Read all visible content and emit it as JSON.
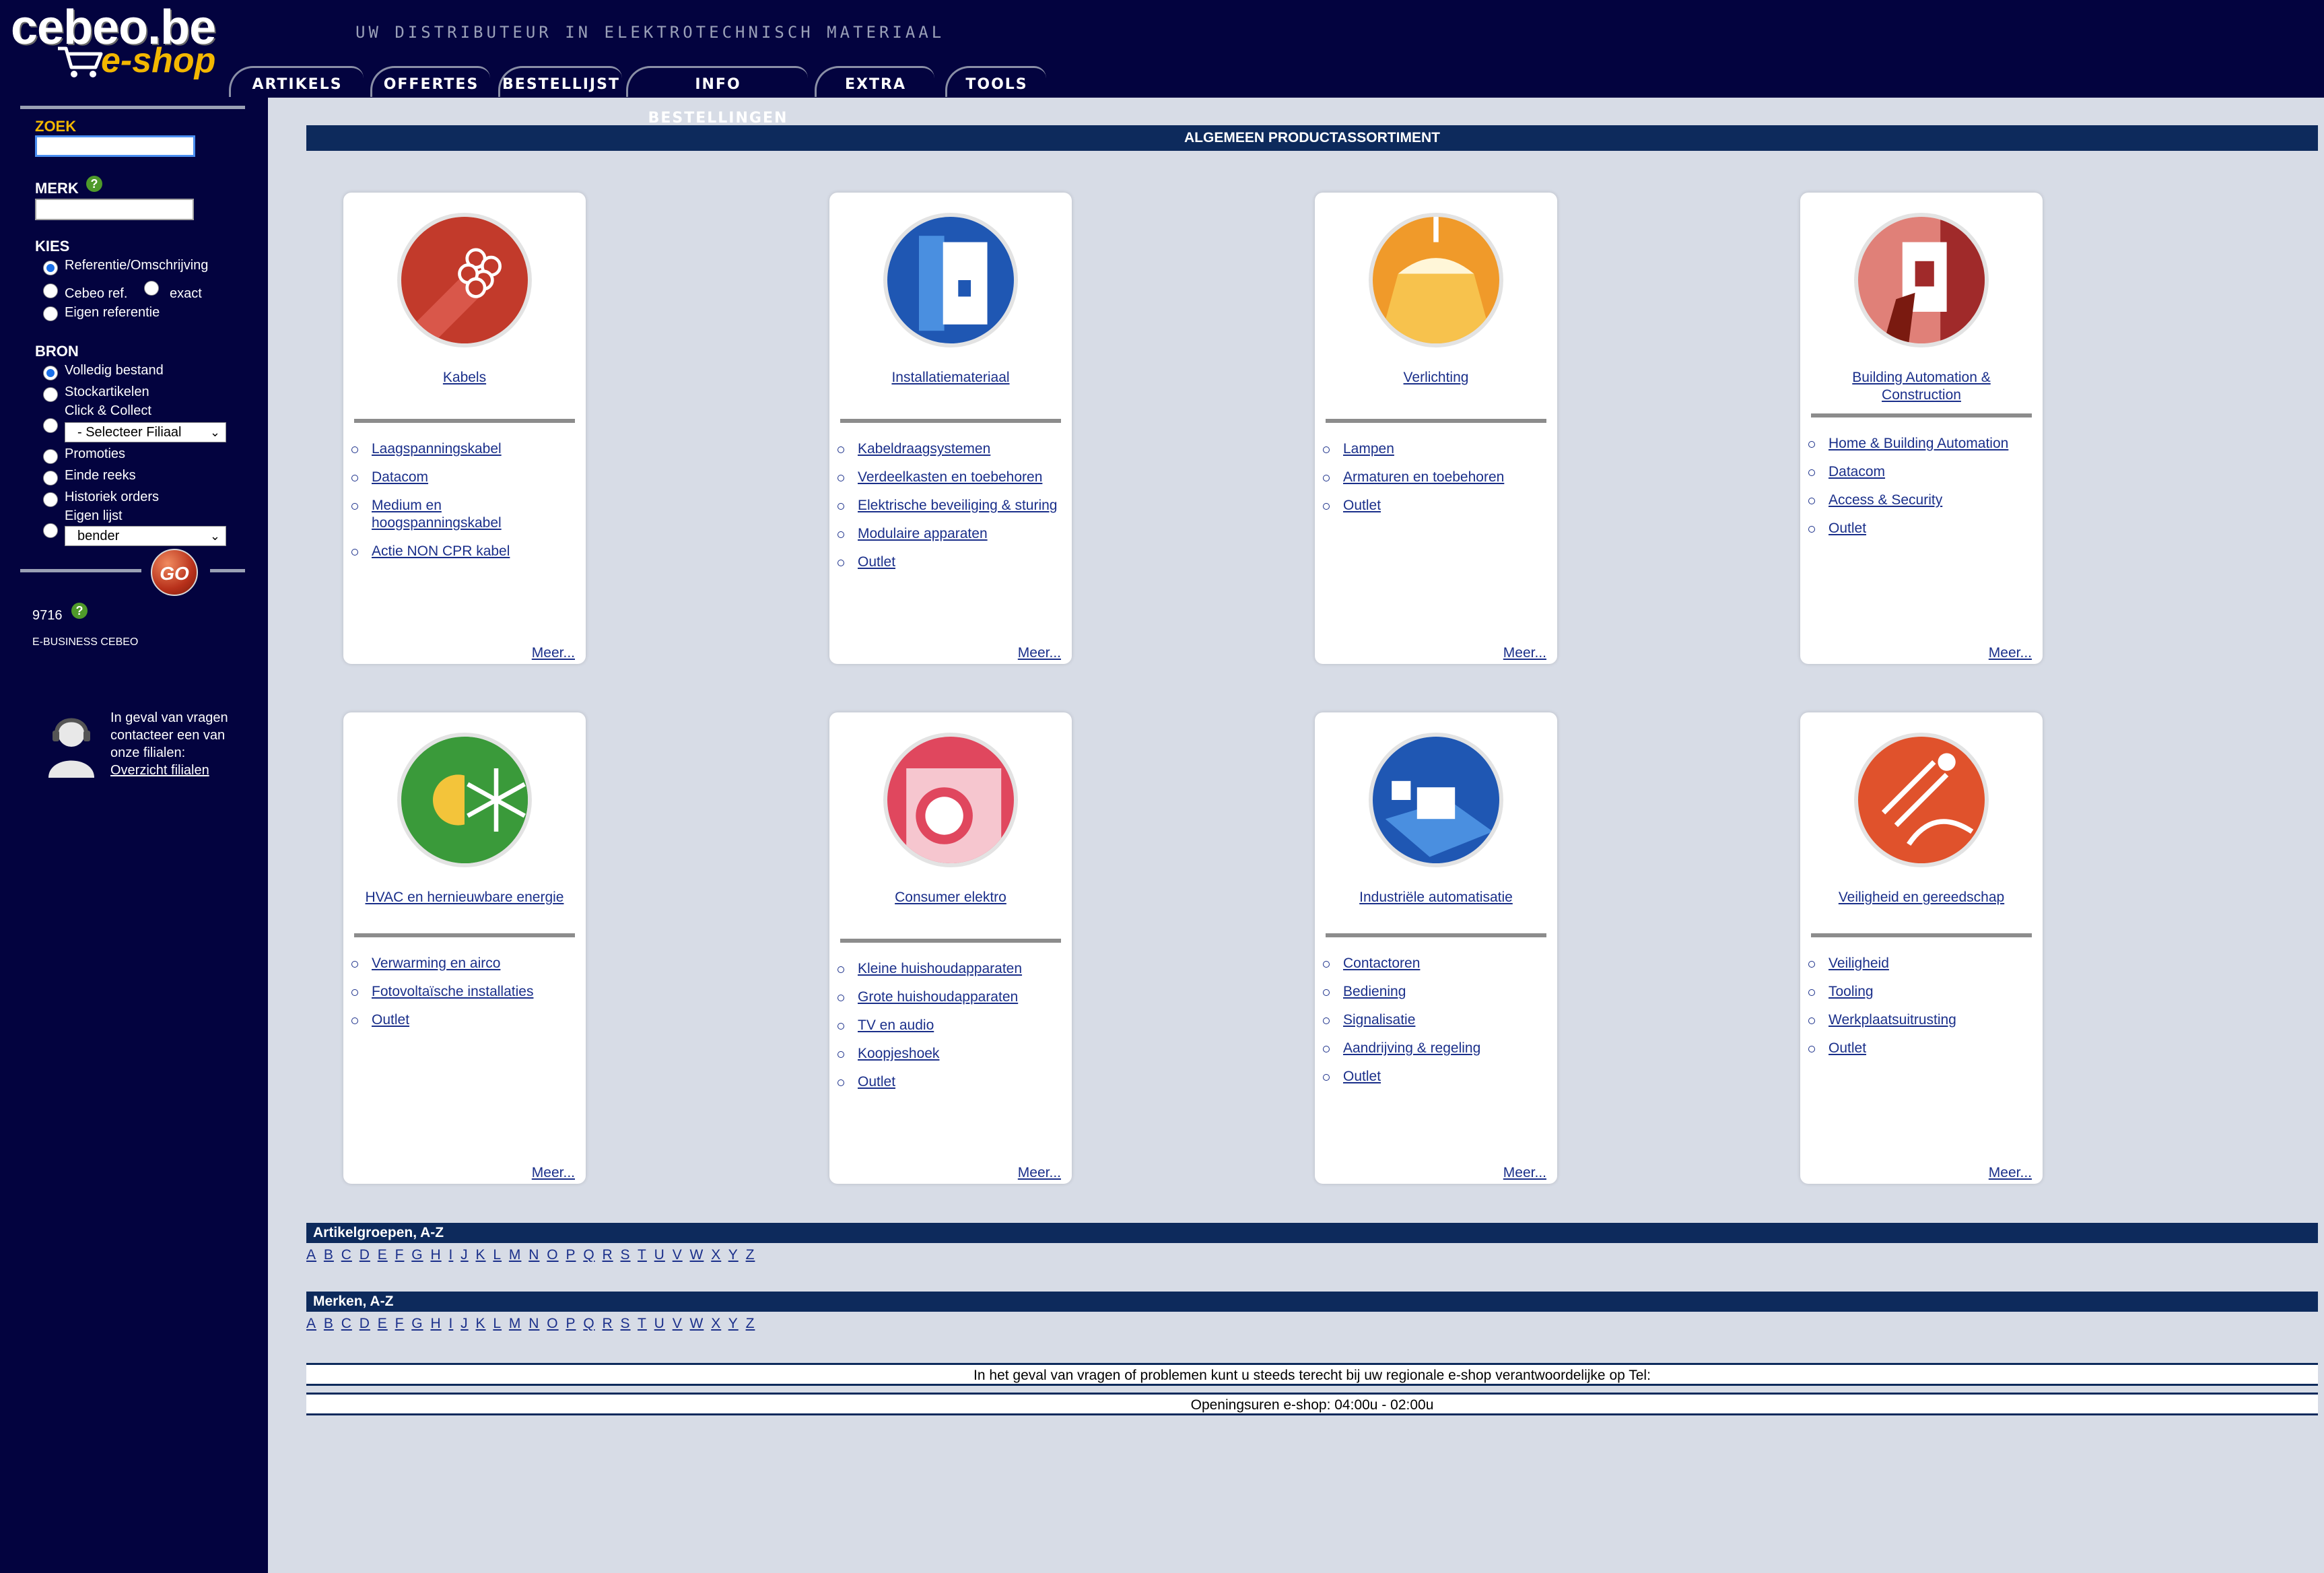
{
  "logo": {
    "main": "cebeo.be",
    "sub": "e-shop"
  },
  "tagline": "UW DISTRIBUTEUR IN ELEKTROTECHNISCH MATERIAAL",
  "nav": {
    "tabs": [
      "ARTIKELS",
      "OFFERTES",
      "BESTELLIJST",
      "INFO BESTELLINGEN",
      "EXTRA",
      "TOOLS"
    ]
  },
  "sidebar": {
    "zoek_label": "ZOEK",
    "merk_label": "MERK",
    "kies_label": "KIES",
    "kies_options": [
      "Referentie/Omschrijving",
      "Cebeo ref.",
      "exact",
      "Eigen referentie"
    ],
    "bron_label": "BRON",
    "bron_options": [
      "Volledig bestand",
      "Stockartikelen",
      "Click & Collect",
      "Promoties",
      "Einde reeks",
      "Historiek orders",
      "Eigen lijst"
    ],
    "filiaal_select": "- Selecteer Filiaal",
    "eigen_lijst_select": "bender",
    "go_label": "GO",
    "account_number": "9716",
    "account_name": "E-BUSINESS CEBEO",
    "contact_text": "In geval van vragen contacteer een van onze filialen:",
    "contact_link": "Overzicht filialen"
  },
  "main": {
    "section_title": "ALGEMEEN PRODUCTASSORTIMENT",
    "more_label": "Meer...",
    "categories": [
      {
        "title": "Kabels",
        "items": [
          "Laagspanningskabel",
          "Datacom",
          "Medium en hoogspanningskabel",
          "Actie NON CPR kabel"
        ]
      },
      {
        "title": "Installatiemateriaal",
        "items": [
          "Kabeldraagsystemen",
          "Verdeelkasten en toebehoren",
          "Elektrische beveiliging & sturing",
          "Modulaire apparaten",
          "Outlet"
        ]
      },
      {
        "title": "Verlichting",
        "items": [
          "Lampen",
          "Armaturen en toebehoren",
          "Outlet"
        ]
      },
      {
        "title": "Building Automation & Construction",
        "items": [
          "Home & Building Automation",
          "Datacom",
          "Access & Security",
          "Outlet"
        ]
      },
      {
        "title": "HVAC en hernieuwbare energie",
        "items": [
          "Verwarming en airco",
          "Fotovoltaïsche installaties",
          "Outlet"
        ]
      },
      {
        "title": "Consumer elektro",
        "items": [
          "Kleine huishoudapparaten",
          "Grote huishoudapparaten",
          "TV en audio",
          "Koopjeshoek",
          "Outlet"
        ]
      },
      {
        "title": "Industriële automatisatie",
        "items": [
          "Contactoren",
          "Bediening",
          "Signalisatie",
          "Aandrijving & regeling",
          "Outlet"
        ]
      },
      {
        "title": "Veiligheid en gereedschap",
        "items": [
          "Veiligheid",
          "Tooling",
          "Werkplaatsuitrusting",
          "Outlet"
        ]
      }
    ],
    "artikelgroepen_title": "Artikelgroepen, A-Z",
    "merken_title": "Merken, A-Z",
    "letters": [
      "A",
      "B",
      "C",
      "D",
      "E",
      "F",
      "G",
      "H",
      "I",
      "J",
      "K",
      "L",
      "M",
      "N",
      "O",
      "P",
      "Q",
      "R",
      "S",
      "T",
      "U",
      "V",
      "W",
      "X",
      "Y",
      "Z"
    ],
    "footer_line1": "In het geval van vragen of problemen kunt u steeds terecht bij uw regionale e-shop verantwoordelijke op Tel:",
    "footer_line2": "Openingsuren e-shop: 04:00u - 02:00u"
  },
  "colors": {
    "header_bg": "#03033f",
    "content_bg": "#d7dce6",
    "bar_bg": "#0d2a5c",
    "link": "#1a2f8a",
    "logo_accent": "#f3b700",
    "zoek_label": "#f3b700"
  }
}
